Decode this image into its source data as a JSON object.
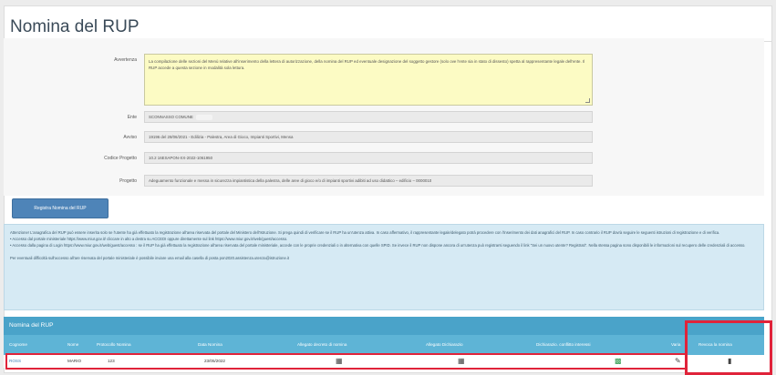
{
  "page": {
    "title": "Nomina del RUP"
  },
  "form": {
    "avvertenza_label": "Avvertenza",
    "avvertenza_text": "La compilazione delle sezioni del Menù relative all'inserimento della lettera di autorizzazione, della nomina del RUP ed eventuale designazione del soggetto gestore (solo ove l'ente sia in stato di dissesto) spetta al rappresentante legale dell'ente. Il RUP accede a questa sezione in modalità sola lettura.",
    "ente_label": "Ente",
    "ente_value": "SCONNASSO COMUNE",
    "avviso_label": "Avviso",
    "avviso_value": "19196 del 28/06/2021 - Edilizia - Palestra, Area di Gioco, Impianti Sportivi, Mensa",
    "codice_label": "Codice Progetto",
    "codice_value": "10.2 16ESAPON-XX-2022-1061950",
    "progetto_label": "Progetto",
    "progetto_value": "Adeguamento funzionale e messa in sicurezza impiantistica della palestra, delle aree di gioco e/o di impianti sportivi adibiti ad uso didattico – edificio – 0000010"
  },
  "actions": {
    "registra_label": "Registra Nomina del RUP"
  },
  "info": {
    "line1": "Attenzione! L'anagrafica del RUP può essere inserita solo se l'utente ha già effettuato la registrazione all'area riservata del portale del Ministero dell'Istruzione. Si prega quindi di verificare se il RUP ha un'utenza attiva. In caso affermativo, il rappresentante legale/delegato potrà procedere con l'inserimento dei dati anagrafici del RUP. In caso contrario il RUP dovrà seguire le seguenti istruzioni di registrazione e di verifica.",
    "line2": "• Accesso dal portale ministeriale https://www.miur.gov.it/ cliccare in alto a destra su ACCEDI oppure direttamente sul link https://www.miur.gov.it/web/guest/accesso.",
    "line3": "• Accesso dalla pagina di Login https://www.miur.gov.it/web/guest/accesso : se il RUP ha già effettuato la registrazione all'area riservata del portale ministeriale, accede con le proprie credenziali o in alternativa con quelle SPID. Se invece il RUP non dispone ancora di un'utenza può registrarsi seguendo il link \"Sei un nuovo utente? Registrati\". Nella stessa pagina sono disponibili le informazioni sul recupero delle credenziali di accesso.",
    "line4": "Per eventuali difficoltà sull'accesso all'are riservata del portale ministeriale è possibile inviare una email alla casella di posta pon2020.assistenza.utenza@istruzione.it"
  },
  "grid": {
    "title": "Nomina del RUP",
    "columns": [
      "Cognome",
      "Nome",
      "Protocollo Nomina",
      "Data Nomina",
      "Allegato decreto di nomina",
      "Allegato Dichiarazio",
      "Dichiarazio. conflitto interessi",
      "Varia",
      "Revoca la nomina"
    ],
    "rows": [
      {
        "cognome": "ROSS",
        "nome": "MARIO",
        "protocollo": "123",
        "data": "23/05/2022"
      }
    ]
  },
  "colors": {
    "grid_header": "#4aa3c9",
    "column_header": "#5eb4d6",
    "highlight": "#e0233a",
    "primary_button": "#4e84b8"
  }
}
